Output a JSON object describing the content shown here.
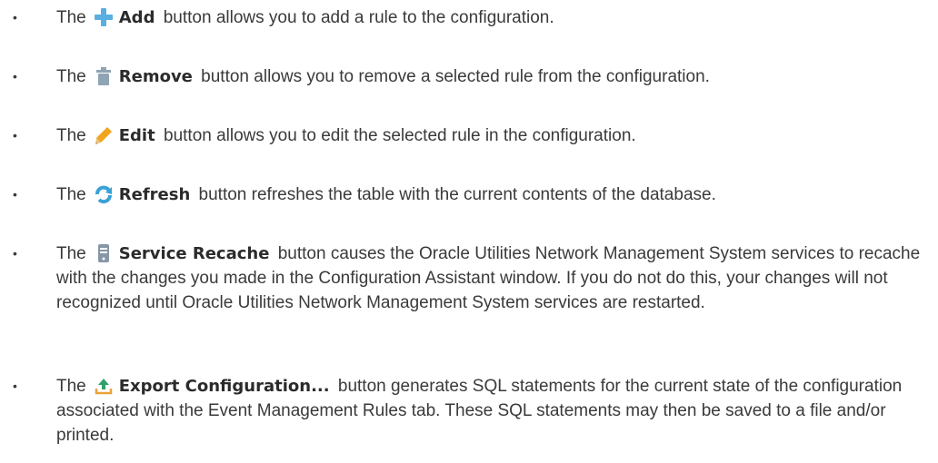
{
  "items": [
    {
      "lead": "The",
      "icon": "plus-icon",
      "button": "Add",
      "text": "button allows you to add a rule to the configuration."
    },
    {
      "lead": "The",
      "icon": "trash-icon",
      "button": "Remove",
      "text": "button allows you to remove a selected rule from the configuration."
    },
    {
      "lead": "The",
      "icon": "pencil-icon",
      "button": "Edit",
      "text": "button allows you to edit the selected rule in the configuration."
    },
    {
      "lead": "The",
      "icon": "refresh-icon",
      "button": "Refresh",
      "text": "button refreshes the table with the current contents of the database."
    },
    {
      "lead": "The",
      "icon": "server-icon",
      "button": "Service Recache",
      "text": "button causes the Oracle Utilities Network Management System services to recache with the changes you made in the Configuration Assistant window. If you do not do this, your changes will not recognized until Oracle Utilities Network Management System services are restarted."
    },
    {
      "lead": "The",
      "icon": "export-icon",
      "button": "Export Configuration...",
      "text": "button generates SQL statements for the current state of the configuration associated with the Event Management Rules tab. These SQL statements may then be saved to a file and/or printed."
    }
  ],
  "bullet_char": "•",
  "colors": {
    "text": "#3a3a3a",
    "plus": "#5aaee0",
    "trash": "#8fa4b4",
    "pencil": "#f2a41c",
    "refresh": "#3aa0d8",
    "server": "#8796a6",
    "export": "#31a06a"
  }
}
